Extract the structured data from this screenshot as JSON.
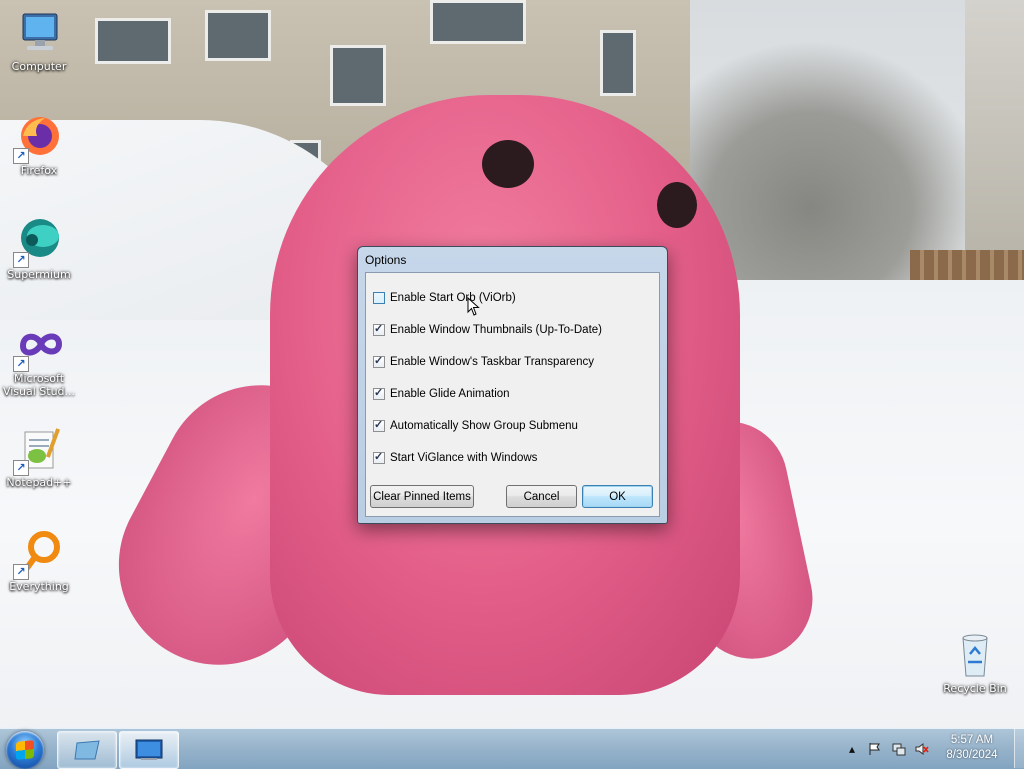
{
  "desktop": {
    "icons": [
      {
        "label": "Computer",
        "icon": "computer-icon"
      },
      {
        "label": "Firefox",
        "icon": "firefox-icon"
      },
      {
        "label": "Supermium",
        "icon": "supermium-icon"
      },
      {
        "label": "Microsoft Visual Stud...",
        "icon": "visual-studio-icon"
      },
      {
        "label": "Notepad++",
        "icon": "notepadpp-icon"
      },
      {
        "label": "Everything",
        "icon": "everything-icon"
      },
      {
        "label": "Recycle Bin",
        "icon": "recycle-bin-icon"
      }
    ]
  },
  "dialog": {
    "title": "Options",
    "options": [
      {
        "label": "Enable Start Orb (ViOrb)",
        "checked": false
      },
      {
        "label": "Enable Window Thumbnails (Up-To-Date)",
        "checked": true
      },
      {
        "label": "Enable Window's Taskbar Transparency",
        "checked": true
      },
      {
        "label": "Enable Glide Animation",
        "checked": true
      },
      {
        "label": "Automatically Show Group Submenu",
        "checked": true
      },
      {
        "label": "Start ViGlance with Windows",
        "checked": true
      }
    ],
    "buttons": {
      "clear": "Clear Pinned Items",
      "cancel": "Cancel",
      "ok": "OK"
    }
  },
  "taskbar": {
    "start_icon": "windows-orb-icon",
    "pinned": [
      {
        "icon": "glass-window-icon",
        "active": false
      },
      {
        "icon": "monitor-window-icon",
        "active": true
      }
    ],
    "tray": {
      "icons": [
        "show-hidden-icons-chevron",
        "action-center-flag-icon",
        "network-icon",
        "volume-muted-icon"
      ],
      "time": "5:57 AM",
      "date": "8/30/2024"
    }
  }
}
